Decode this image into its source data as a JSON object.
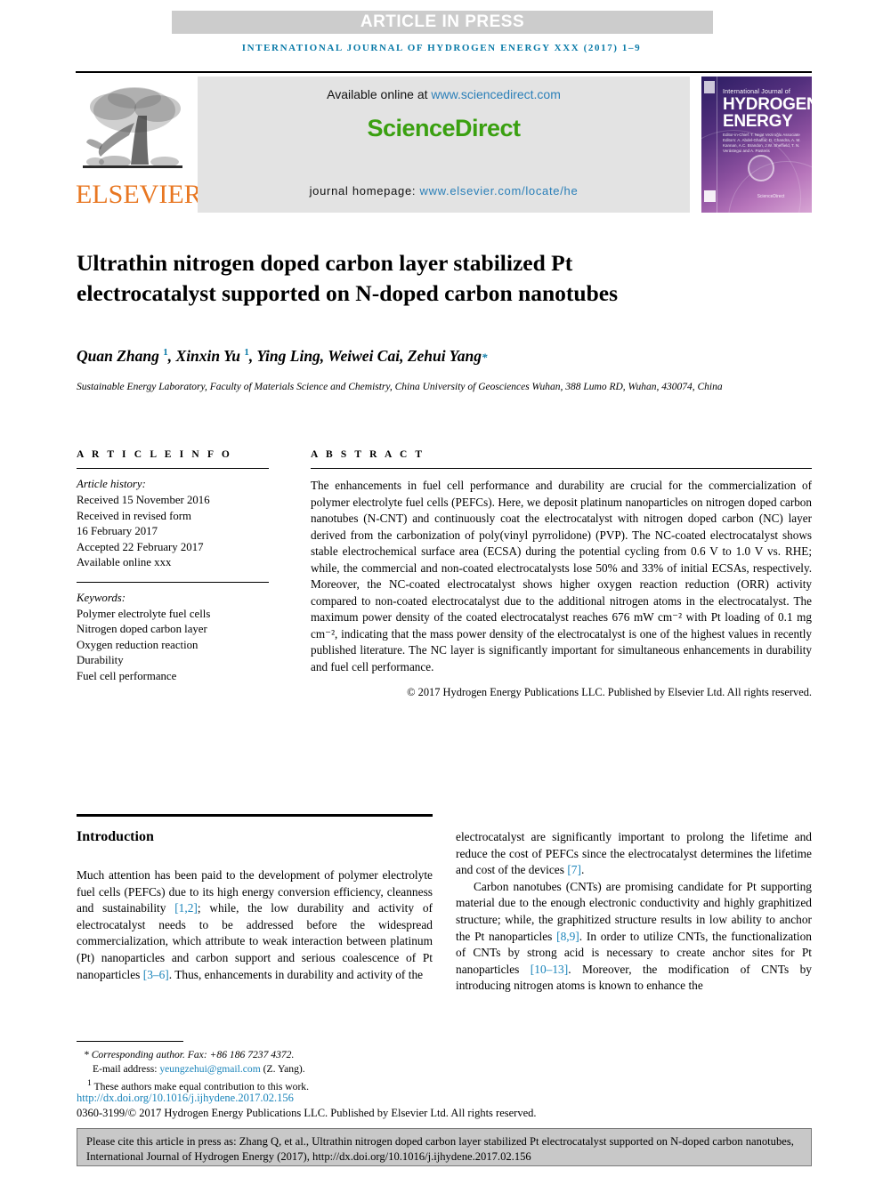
{
  "banner": {
    "text": "ARTICLE IN PRESS",
    "bg_color": "#cccccc",
    "text_color": "#ffffff"
  },
  "running_head": {
    "text": "INTERNATIONAL JOURNAL OF HYDROGEN ENERGY XXX (2017) 1–9",
    "color": "#0b7ba8"
  },
  "masthead": {
    "publisher_logo_text": "ELSEVIER",
    "publisher_logo_color": "#e87722",
    "available_prefix": "Available online at ",
    "available_url": "www.sciencedirect.com",
    "sciencedirect_logo": "ScienceDirect",
    "sciencedirect_color": "#3aa010",
    "homepage_prefix": "journal homepage: ",
    "homepage_url": "www.elsevier.com/locate/he",
    "link_color": "#2a7fb8",
    "panel_bg": "#e3e3e3",
    "cover": {
      "line1": "International Journal of",
      "headline1": "HYDROGEN",
      "headline2": "ENERGY",
      "editors": "Editor-in-Chief:  T. Nejat Veziroğlu    Associate Editors:  A. Abdel-Ghaffar, D. Chandra, A. M. Kannan, A.C. Brandon, J.W. Sheffield, T. N. Verástegui and A. Pasteris",
      "sciencedirect_mark": "ScienceDirect"
    }
  },
  "article": {
    "title": "Ultrathin nitrogen doped carbon layer stabilized Pt electrocatalyst supported on N-doped carbon nanotubes",
    "authors_html": "Quan Zhang <sup>1</sup>, Xinxin Yu <sup>1</sup>, Ying Ling, Weiwei Cai, Zehui Yang<span class=\"star\">*</span>",
    "affiliation": "Sustainable Energy Laboratory, Faculty of Materials Science and Chemistry, China University of Geosciences Wuhan, 388 Lumo RD, Wuhan, 430074, China"
  },
  "article_info": {
    "label": "A R T I C L E    I N F O",
    "history_label": "Article history:",
    "history": [
      "Received 15 November 2016",
      "Received in revised form",
      "16 February 2017",
      "Accepted 22 February 2017",
      "Available online xxx"
    ],
    "keywords_label": "Keywords:",
    "keywords": [
      "Polymer electrolyte fuel cells",
      "Nitrogen doped carbon layer",
      "Oxygen reduction reaction",
      "Durability",
      "Fuel cell performance"
    ]
  },
  "abstract": {
    "label": "A B S T R A C T",
    "text": "The enhancements in fuel cell performance and durability are crucial for the commercialization of polymer electrolyte fuel cells (PEFCs). Here, we deposit platinum nanoparticles on nitrogen doped carbon nanotubes (N-CNT) and continuously coat the electrocatalyst with nitrogen doped carbon (NC) layer derived from the carbonization of poly(vinyl pyrrolidone) (PVP). The NC-coated electrocatalyst shows stable electrochemical surface area (ECSA) during the potential cycling from 0.6 V to 1.0 V vs. RHE; while, the commercial and non-coated electrocatalysts lose 50% and 33% of initial ECSAs, respectively. Moreover, the NC-coated electrocatalyst shows higher oxygen reaction reduction (ORR) activity compared to non-coated electrocatalyst due to the additional nitrogen atoms in the electrocatalyst. The maximum power density of the coated electrocatalyst reaches 676 mW cm⁻² with Pt loading of 0.1 mg cm⁻², indicating that the mass power density of the electrocatalyst is one of the highest values in recently published literature. The NC layer is significantly important for simultaneous enhancements in durability and fuel cell performance.",
    "copyright": "© 2017 Hydrogen Energy Publications LLC. Published by Elsevier Ltd. All rights reserved."
  },
  "introduction": {
    "heading": "Introduction",
    "left_paragraph_html": "Much attention has been paid to the development of polymer electrolyte fuel cells (PEFCs) due to its high energy conversion efficiency, cleanness and sustainability <span class=\"ref\">[1,2]</span>; while, the low durability and activity of electrocatalyst needs to be addressed before the widespread commercialization, which attribute to weak interaction between platinum (Pt) nanoparticles and carbon support and serious coalescence of Pt nanoparticles <span class=\"ref\">[3&ndash;6]</span>. Thus, enhancements in durability and activity of the",
    "right_paragraph1_html": "electrocatalyst are significantly important to prolong the lifetime and reduce the cost of PEFCs since the electrocatalyst determines the lifetime and cost of the devices <span class=\"ref\">[7]</span>.",
    "right_paragraph2_html": "Carbon nanotubes (CNTs) are promising candidate for Pt supporting material due to the enough electronic conductivity and highly graphitized structure; while, the graphitized structure results in low ability to anchor the Pt nanoparticles <span class=\"ref\">[8,9]</span>. In order to utilize CNTs, the functionalization of CNTs by strong acid is necessary to create anchor sites for Pt nanoparticles <span class=\"ref\">[10&ndash;13]</span>. Moreover, the modification of CNTs by introducing nitrogen atoms is known to enhance the"
  },
  "footnotes": {
    "corresponding_html": "<span class=\"fn-star\">* Corresponding author. Fax: +86 186 7237 4372.</span>",
    "email_html": "E-mail address: <span class=\"link\">yeungzehui@gmail.com</span> (Z. Yang).",
    "equal_contribution_html": "<sup>1</sup> These authors make equal contribution to this work.",
    "doi": "http://dx.doi.org/10.1016/j.ijhydene.2017.02.156",
    "issn_line": "0360-3199/© 2017 Hydrogen Energy Publications LLC. Published by Elsevier Ltd. All rights reserved.",
    "link_color": "#1a84ba"
  },
  "cite_box": {
    "text": "Please cite this article in press as: Zhang Q, et al., Ultrathin nitrogen doped carbon layer stabilized Pt electrocatalyst supported on N-doped carbon nanotubes, International Journal of Hydrogen Energy (2017), http://dx.doi.org/10.1016/j.ijhydene.2017.02.156",
    "bg_color": "#c8c8c8",
    "border_color": "#7a7a7a"
  }
}
